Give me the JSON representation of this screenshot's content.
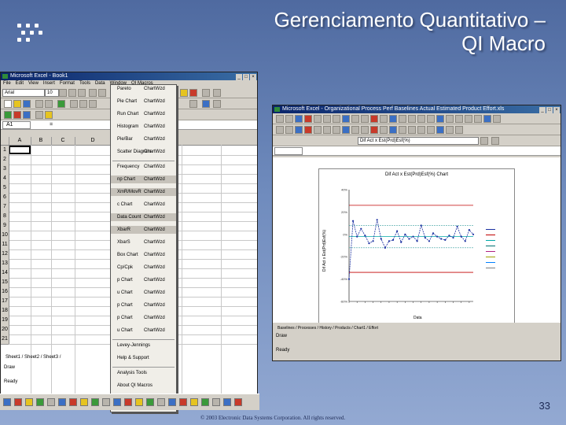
{
  "slide": {
    "title_line1": "Gerenciamento Quantitativo –",
    "title_line2": "QI Macro",
    "page_number": "33",
    "footer": "© 2003 Electronic Data Systems Corporation. All rights reserved."
  },
  "left_window": {
    "title": "Microsoft Excel - Book1",
    "menus": [
      "File",
      "Edit",
      "View",
      "Insert",
      "Format",
      "Tools",
      "Data",
      "Window",
      "QI Macros"
    ],
    "font_name": "Arial",
    "font_size": "10",
    "name_box": "A1",
    "formula_label": "=",
    "columns": [
      "A",
      "B",
      "C",
      "D"
    ],
    "rows": [
      "1",
      "2",
      "3",
      "4",
      "5",
      "6",
      "7",
      "8",
      "9",
      "10",
      "11",
      "12",
      "13",
      "14",
      "15",
      "16",
      "17",
      "18",
      "19",
      "20",
      "21"
    ],
    "sheet_tabs": "Sheet1 / Sheet2 / Sheet3 /",
    "draw_label": "Draw",
    "ready_label": "Ready"
  },
  "qi_menu": {
    "items": [
      {
        "label": "Pareto",
        "sub": "ChartWzd"
      },
      {
        "label": "Pie Chart",
        "sub": "ChartWzd"
      },
      {
        "label": "Run Chart",
        "sub": "ChartWzd"
      },
      {
        "label": "Histogram",
        "sub": "ChartWzd"
      },
      {
        "label": "Pie/Bar",
        "sub": "ChartWzd"
      },
      {
        "label": "Scatter Diagram",
        "sub": "ChartWzd"
      },
      {
        "label": "Frequency",
        "sub": "ChartWzd"
      },
      {
        "label": "np Chart",
        "sub": "ChartWzd"
      },
      {
        "label": "XmR/MovR",
        "sub": "ChartWzd"
      },
      {
        "label": "c Chart",
        "sub": "ChartWzd"
      },
      {
        "label": "Data Count",
        "sub": "ChartWzd"
      },
      {
        "label": "XbarR",
        "sub": "ChartWzd"
      },
      {
        "label": "XbarS",
        "sub": "ChartWzd"
      },
      {
        "label": "Box Chart",
        "sub": "ChartWzd"
      },
      {
        "label": "Cp/Cpk",
        "sub": "ChartWzd"
      },
      {
        "label": "p Chart",
        "sub": "ChartWzd"
      },
      {
        "label": "u Chart",
        "sub": "ChartWzd"
      },
      {
        "label": "p Chart",
        "sub": "ChartWzd"
      },
      {
        "label": "p Chart",
        "sub": "ChartWzd"
      },
      {
        "label": "u Chart",
        "sub": "ChartWzd"
      },
      {
        "label": "Levey-Jennings",
        "sub": ""
      },
      {
        "label": "Help & Support",
        "sub": ""
      },
      {
        "label": "Analysis Tools",
        "sub": ""
      },
      {
        "label": "About QI Macros",
        "sub": ""
      }
    ]
  },
  "right_window": {
    "title": "Microsoft Excel - Organizational Process Perf Baselines Actual Estimated Product Effort.xls",
    "menus": [
      "File",
      "Edit",
      "View",
      "Insert",
      "Format",
      "Tools",
      "Data",
      "Window",
      "QI Macros",
      "Help"
    ],
    "formula_ref": "",
    "font_name": "Arial",
    "chart_title": "Dif Act x Est(Prd)Esf(%) Chart",
    "y_axis_title": "Dif Act x Est(Prd)Esf(%)",
    "x_axis_title": "Data",
    "sheet_tabs": "Baselines / Processes / History / Products / Chart1 / Effort",
    "draw_label": "Draw",
    "ready_label": "Ready"
  },
  "chart_data": {
    "type": "line",
    "title": "Dif Act x Est(Prd)Esf(%) Chart",
    "ylabel": "Dif Act x Est(Prd)Esf(%)",
    "xlabel": "Data",
    "ylim": [
      -60,
      40
    ],
    "yticks": [
      "40%",
      "20%",
      "0%",
      "-20%",
      "-40%",
      "-60%"
    ],
    "series": [
      {
        "name": "",
        "values": [
          -40,
          12,
          -2,
          5,
          -1,
          -8,
          -6,
          13,
          -4,
          -12,
          -6,
          -5,
          3,
          -7,
          0,
          -4,
          -2,
          -6,
          8,
          -3,
          -6,
          1,
          -2,
          -4,
          -5,
          -1,
          -3,
          7,
          -2,
          -6,
          4,
          0
        ]
      }
    ],
    "ucl": 26,
    "lcl": -34,
    "center": -2
  },
  "colors": {
    "slide_bg": "#6d88b8",
    "series": "#1a2fa0",
    "ucl": "#c00000",
    "lcl": "#c00000",
    "center": "#00a8a8",
    "sigma": "#3aa0a0"
  }
}
